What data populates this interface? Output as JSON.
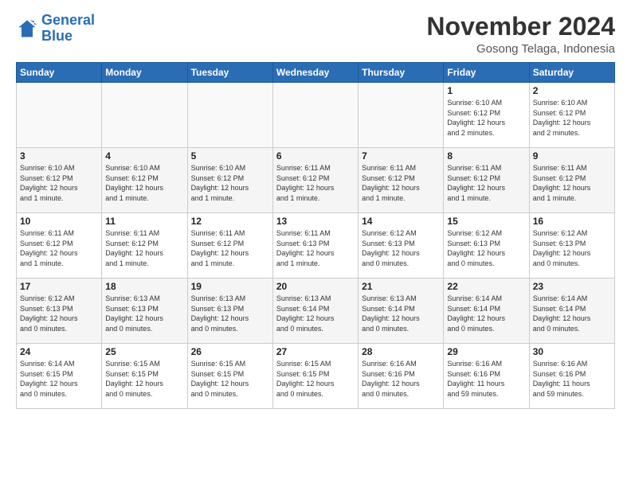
{
  "logo": {
    "line1": "General",
    "line2": "Blue"
  },
  "title": "November 2024",
  "subtitle": "Gosong Telaga, Indonesia",
  "days_of_week": [
    "Sunday",
    "Monday",
    "Tuesday",
    "Wednesday",
    "Thursday",
    "Friday",
    "Saturday"
  ],
  "weeks": [
    [
      {
        "day": "",
        "info": ""
      },
      {
        "day": "",
        "info": ""
      },
      {
        "day": "",
        "info": ""
      },
      {
        "day": "",
        "info": ""
      },
      {
        "day": "",
        "info": ""
      },
      {
        "day": "1",
        "info": "Sunrise: 6:10 AM\nSunset: 6:12 PM\nDaylight: 12 hours\nand 2 minutes."
      },
      {
        "day": "2",
        "info": "Sunrise: 6:10 AM\nSunset: 6:12 PM\nDaylight: 12 hours\nand 2 minutes."
      }
    ],
    [
      {
        "day": "3",
        "info": "Sunrise: 6:10 AM\nSunset: 6:12 PM\nDaylight: 12 hours\nand 1 minute."
      },
      {
        "day": "4",
        "info": "Sunrise: 6:10 AM\nSunset: 6:12 PM\nDaylight: 12 hours\nand 1 minute."
      },
      {
        "day": "5",
        "info": "Sunrise: 6:10 AM\nSunset: 6:12 PM\nDaylight: 12 hours\nand 1 minute."
      },
      {
        "day": "6",
        "info": "Sunrise: 6:11 AM\nSunset: 6:12 PM\nDaylight: 12 hours\nand 1 minute."
      },
      {
        "day": "7",
        "info": "Sunrise: 6:11 AM\nSunset: 6:12 PM\nDaylight: 12 hours\nand 1 minute."
      },
      {
        "day": "8",
        "info": "Sunrise: 6:11 AM\nSunset: 6:12 PM\nDaylight: 12 hours\nand 1 minute."
      },
      {
        "day": "9",
        "info": "Sunrise: 6:11 AM\nSunset: 6:12 PM\nDaylight: 12 hours\nand 1 minute."
      }
    ],
    [
      {
        "day": "10",
        "info": "Sunrise: 6:11 AM\nSunset: 6:12 PM\nDaylight: 12 hours\nand 1 minute."
      },
      {
        "day": "11",
        "info": "Sunrise: 6:11 AM\nSunset: 6:12 PM\nDaylight: 12 hours\nand 1 minute."
      },
      {
        "day": "12",
        "info": "Sunrise: 6:11 AM\nSunset: 6:12 PM\nDaylight: 12 hours\nand 1 minute."
      },
      {
        "day": "13",
        "info": "Sunrise: 6:11 AM\nSunset: 6:13 PM\nDaylight: 12 hours\nand 1 minute."
      },
      {
        "day": "14",
        "info": "Sunrise: 6:12 AM\nSunset: 6:13 PM\nDaylight: 12 hours\nand 0 minutes."
      },
      {
        "day": "15",
        "info": "Sunrise: 6:12 AM\nSunset: 6:13 PM\nDaylight: 12 hours\nand 0 minutes."
      },
      {
        "day": "16",
        "info": "Sunrise: 6:12 AM\nSunset: 6:13 PM\nDaylight: 12 hours\nand 0 minutes."
      }
    ],
    [
      {
        "day": "17",
        "info": "Sunrise: 6:12 AM\nSunset: 6:13 PM\nDaylight: 12 hours\nand 0 minutes."
      },
      {
        "day": "18",
        "info": "Sunrise: 6:13 AM\nSunset: 6:13 PM\nDaylight: 12 hours\nand 0 minutes."
      },
      {
        "day": "19",
        "info": "Sunrise: 6:13 AM\nSunset: 6:13 PM\nDaylight: 12 hours\nand 0 minutes."
      },
      {
        "day": "20",
        "info": "Sunrise: 6:13 AM\nSunset: 6:14 PM\nDaylight: 12 hours\nand 0 minutes."
      },
      {
        "day": "21",
        "info": "Sunrise: 6:13 AM\nSunset: 6:14 PM\nDaylight: 12 hours\nand 0 minutes."
      },
      {
        "day": "22",
        "info": "Sunrise: 6:14 AM\nSunset: 6:14 PM\nDaylight: 12 hours\nand 0 minutes."
      },
      {
        "day": "23",
        "info": "Sunrise: 6:14 AM\nSunset: 6:14 PM\nDaylight: 12 hours\nand 0 minutes."
      }
    ],
    [
      {
        "day": "24",
        "info": "Sunrise: 6:14 AM\nSunset: 6:15 PM\nDaylight: 12 hours\nand 0 minutes."
      },
      {
        "day": "25",
        "info": "Sunrise: 6:15 AM\nSunset: 6:15 PM\nDaylight: 12 hours\nand 0 minutes."
      },
      {
        "day": "26",
        "info": "Sunrise: 6:15 AM\nSunset: 6:15 PM\nDaylight: 12 hours\nand 0 minutes."
      },
      {
        "day": "27",
        "info": "Sunrise: 6:15 AM\nSunset: 6:15 PM\nDaylight: 12 hours\nand 0 minutes."
      },
      {
        "day": "28",
        "info": "Sunrise: 6:16 AM\nSunset: 6:16 PM\nDaylight: 12 hours\nand 0 minutes."
      },
      {
        "day": "29",
        "info": "Sunrise: 6:16 AM\nSunset: 6:16 PM\nDaylight: 11 hours\nand 59 minutes."
      },
      {
        "day": "30",
        "info": "Sunrise: 6:16 AM\nSunset: 6:16 PM\nDaylight: 11 hours\nand 59 minutes."
      }
    ]
  ]
}
